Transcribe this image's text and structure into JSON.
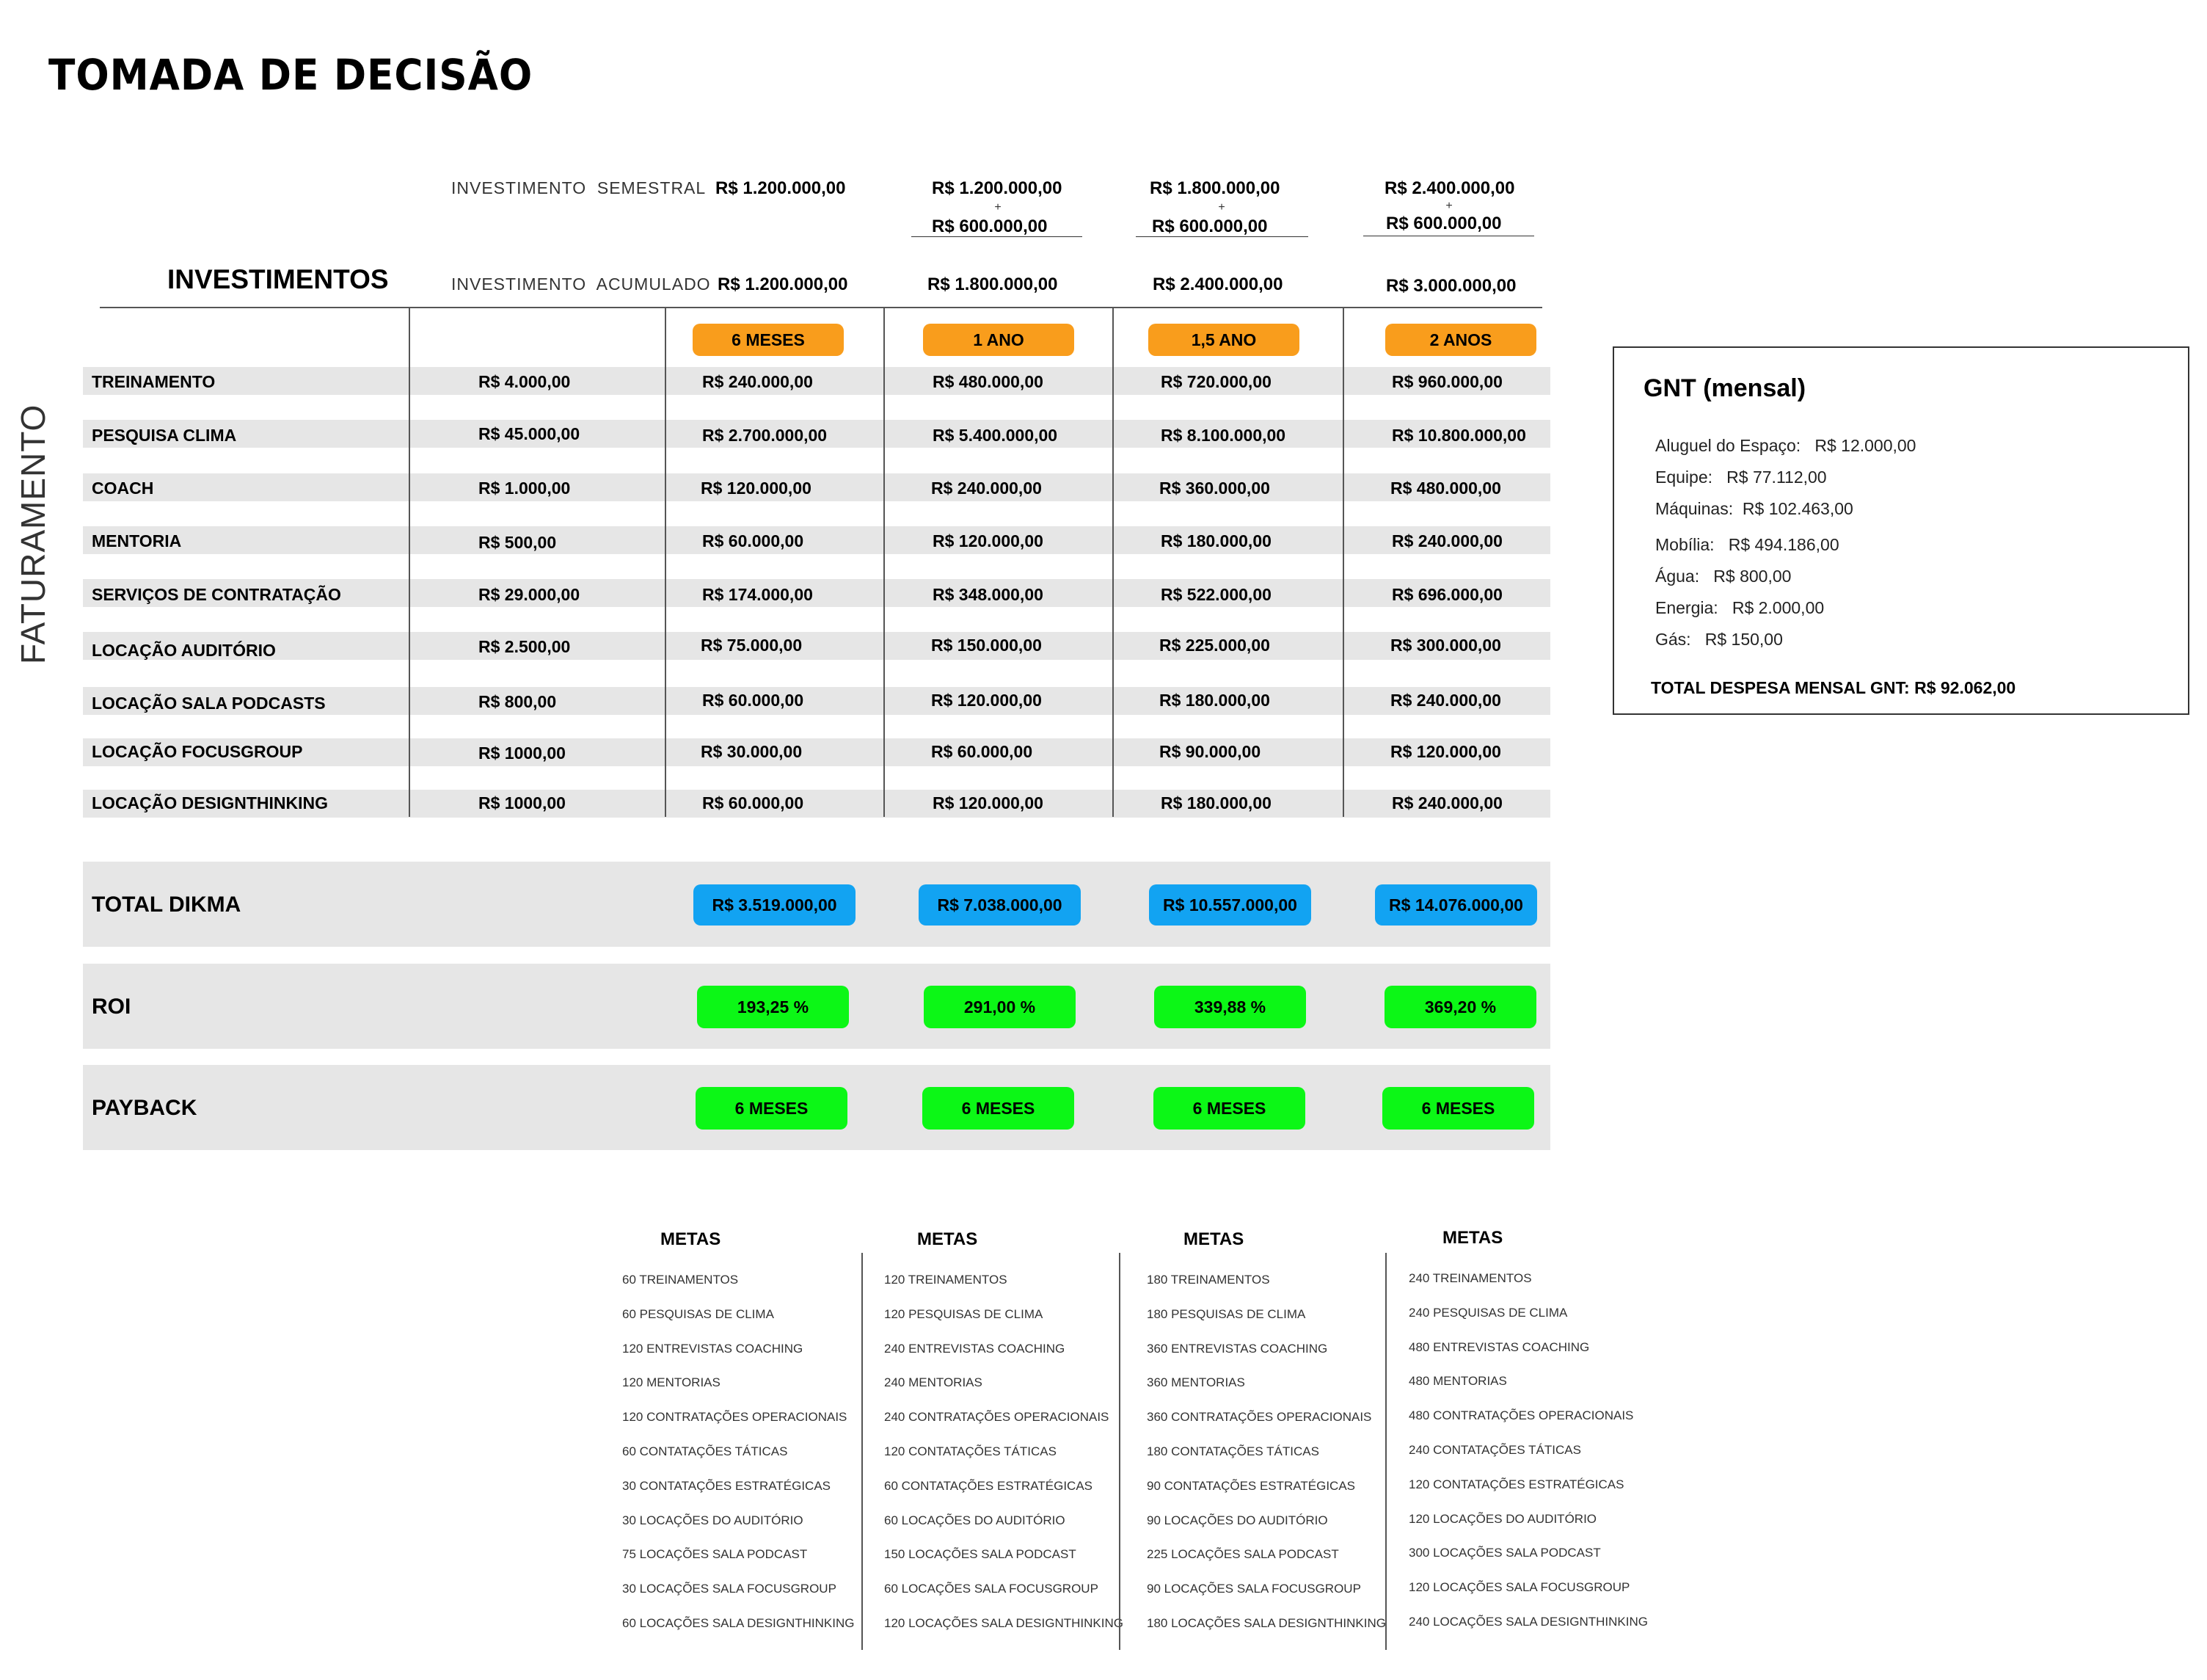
{
  "title": "TOMADA DE DECISÃO",
  "side_label": "FATURAMENTO",
  "investments": {
    "section_label": "INVESTIMENTOS",
    "semestral_label": "INVESTIMENTO  SEMESTRAL",
    "acumulado_label": "INVESTIMENTO  ACUMULADO",
    "semestral": [
      {
        "top": "R$ 1.200.000,00",
        "plus": "",
        "bottom": ""
      },
      {
        "top": "R$ 1.200.000,00",
        "plus": "+",
        "bottom": "R$ 600.000,00"
      },
      {
        "top": "R$ 1.800.000,00",
        "plus": "+",
        "bottom": "R$ 600.000,00"
      },
      {
        "top": "R$ 2.400.000,00",
        "plus": "+",
        "bottom": "R$ 600.000,00"
      }
    ],
    "acumulado": [
      "R$ 1.200.000,00",
      "R$ 1.800.000,00",
      "R$ 2.400.000,00",
      "R$ 3.000.000,00"
    ]
  },
  "periods": [
    "6 MESES",
    "1 ANO",
    "1,5 ANO",
    "2 ANOS"
  ],
  "rows": [
    {
      "label": "TREINAMENTO",
      "unit": "R$ 4.000,00",
      "values": [
        "R$ 240.000,00",
        "R$ 480.000,00",
        "R$ 720.000,00",
        "R$ 960.000,00"
      ]
    },
    {
      "label": "PESQUISA CLIMA",
      "unit": "R$ 45.000,00",
      "values": [
        "R$ 2.700.000,00",
        "R$ 5.400.000,00",
        "R$ 8.100.000,00",
        "R$ 10.800.000,00"
      ]
    },
    {
      "label": "COACH",
      "unit": "R$ 1.000,00",
      "values": [
        "R$ 120.000,00",
        "R$ 240.000,00",
        "R$ 360.000,00",
        "R$ 480.000,00"
      ]
    },
    {
      "label": "MENTORIA",
      "unit": "R$ 500,00",
      "values": [
        "R$ 60.000,00",
        "R$ 120.000,00",
        "R$ 180.000,00",
        "R$ 240.000,00"
      ]
    },
    {
      "label": "SERVIÇOS DE CONTRATAÇÃO",
      "unit": "R$ 29.000,00",
      "values": [
        "R$ 174.000,00",
        "R$ 348.000,00",
        "R$ 522.000,00",
        "R$ 696.000,00"
      ]
    },
    {
      "label": "LOCAÇÃO AUDITÓRIO",
      "unit": "R$ 2.500,00",
      "values": [
        "R$ 75.000,00",
        "R$ 150.000,00",
        "R$ 225.000,00",
        "R$ 300.000,00"
      ]
    },
    {
      "label": "LOCAÇÃO SALA PODCASTS",
      "unit": "R$ 800,00",
      "values": [
        "R$ 60.000,00",
        "R$ 120.000,00",
        "R$ 180.000,00",
        "R$ 240.000,00"
      ]
    },
    {
      "label": "LOCAÇÃO FOCUSGROUP",
      "unit": "R$ 1000,00",
      "values": [
        "R$ 30.000,00",
        "R$ 60.000,00",
        "R$ 90.000,00",
        "R$ 120.000,00"
      ]
    },
    {
      "label": "LOCAÇÃO DESIGNTHINKING",
      "unit": "R$ 1000,00",
      "values": [
        "R$ 60.000,00",
        "R$ 120.000,00",
        "R$ 180.000,00",
        "R$ 240.000,00"
      ]
    }
  ],
  "total": {
    "label": "TOTAL DIKMA",
    "values": [
      "R$ 3.519.000,00",
      "R$ 7.038.000,00",
      "R$ 10.557.000,00",
      "R$ 14.076.000,00"
    ]
  },
  "roi": {
    "label": "ROI",
    "values": [
      "193,25 %",
      "291,00 %",
      "339,88 %",
      "369,20 %"
    ]
  },
  "payback": {
    "label": "PAYBACK",
    "values": [
      "6 MESES",
      "6 MESES",
      "6 MESES",
      "6 MESES"
    ]
  },
  "gnt": {
    "title": "GNT (mensal)",
    "items": [
      "Aluguel do Espaço:   R$ 12.000,00",
      "Equipe:   R$ 77.112,00",
      "Máquinas:  R$ 102.463,00",
      "Mobília:   R$ 494.186,00",
      "Água:   R$ 800,00",
      "Energia:   R$ 2.000,00",
      "Gás:   R$ 150,00"
    ],
    "total": "TOTAL DESPESA MENSAL GNT: R$ 92.062,00"
  },
  "metas": [
    {
      "title": "METAS",
      "items": [
        "60 TREINAMENTOS",
        "60 PESQUISAS DE CLIMA",
        "120 ENTREVISTAS COACHING",
        "120 MENTORIAS",
        "120 CONTRATAÇÕES OPERACIONAIS",
        "60 CONTATAÇÕES TÁTICAS",
        "30 CONTATAÇÕES ESTRATÉGICAS",
        "30 LOCAÇÕES DO AUDITÓRIO",
        "75 LOCAÇÕES SALA PODCAST",
        "30 LOCAÇÕES SALA FOCUSGROUP",
        "60 LOCAÇÕES SALA DESIGNTHINKING"
      ]
    },
    {
      "title": "METAS",
      "items": [
        "120 TREINAMENTOS",
        "120 PESQUISAS DE CLIMA",
        "240 ENTREVISTAS COACHING",
        "240 MENTORIAS",
        "240 CONTRATAÇÕES OPERACIONAIS",
        "120 CONTATAÇÕES TÁTICAS",
        "60 CONTATAÇÕES ESTRATÉGICAS",
        "60 LOCAÇÕES DO AUDITÓRIO",
        "150 LOCAÇÕES SALA PODCAST",
        "60 LOCAÇÕES SALA FOCUSGROUP",
        "120 LOCAÇÕES SALA DESIGNTHINKING"
      ]
    },
    {
      "title": "METAS",
      "items": [
        "180 TREINAMENTOS",
        "180 PESQUISAS DE CLIMA",
        "360 ENTREVISTAS COACHING",
        "360 MENTORIAS",
        "360 CONTRATAÇÕES OPERACIONAIS",
        "180 CONTATAÇÕES TÁTICAS",
        "90 CONTATAÇÕES ESTRATÉGICAS",
        "90 LOCAÇÕES DO AUDITÓRIO",
        "225 LOCAÇÕES SALA PODCAST",
        "90 LOCAÇÕES SALA FOCUSGROUP",
        "180 LOCAÇÕES SALA DESIGNTHINKING"
      ]
    },
    {
      "title": "METAS",
      "items": [
        "240 TREINAMENTOS",
        "240 PESQUISAS DE CLIMA",
        "480 ENTREVISTAS COACHING",
        "480 MENTORIAS",
        "480 CONTRATAÇÕES OPERACIONAIS",
        "240 CONTATAÇÕES TÁTICAS",
        "120 CONTATAÇÕES ESTRATÉGICAS",
        "120 LOCAÇÕES DO AUDITÓRIO",
        "300 LOCAÇÕES SALA PODCAST",
        "120 LOCAÇÕES SALA FOCUSGROUP",
        "240 LOCAÇÕES SALA DESIGNTHINKING"
      ]
    }
  ]
}
